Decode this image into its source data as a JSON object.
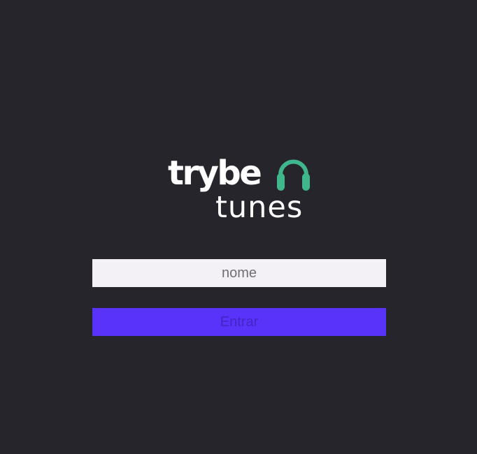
{
  "logo": {
    "word_top": "trybe",
    "word_bottom": "tunes",
    "icon": "headphones-icon",
    "icon_color": "#3fb68b"
  },
  "login": {
    "name_placeholder": "nome",
    "name_value": "",
    "enter_label": "Entrar"
  },
  "colors": {
    "background": "#27252c",
    "input_background": "#f3f1f6",
    "button_background": "#5a33fb",
    "button_text": "#4525c2"
  }
}
